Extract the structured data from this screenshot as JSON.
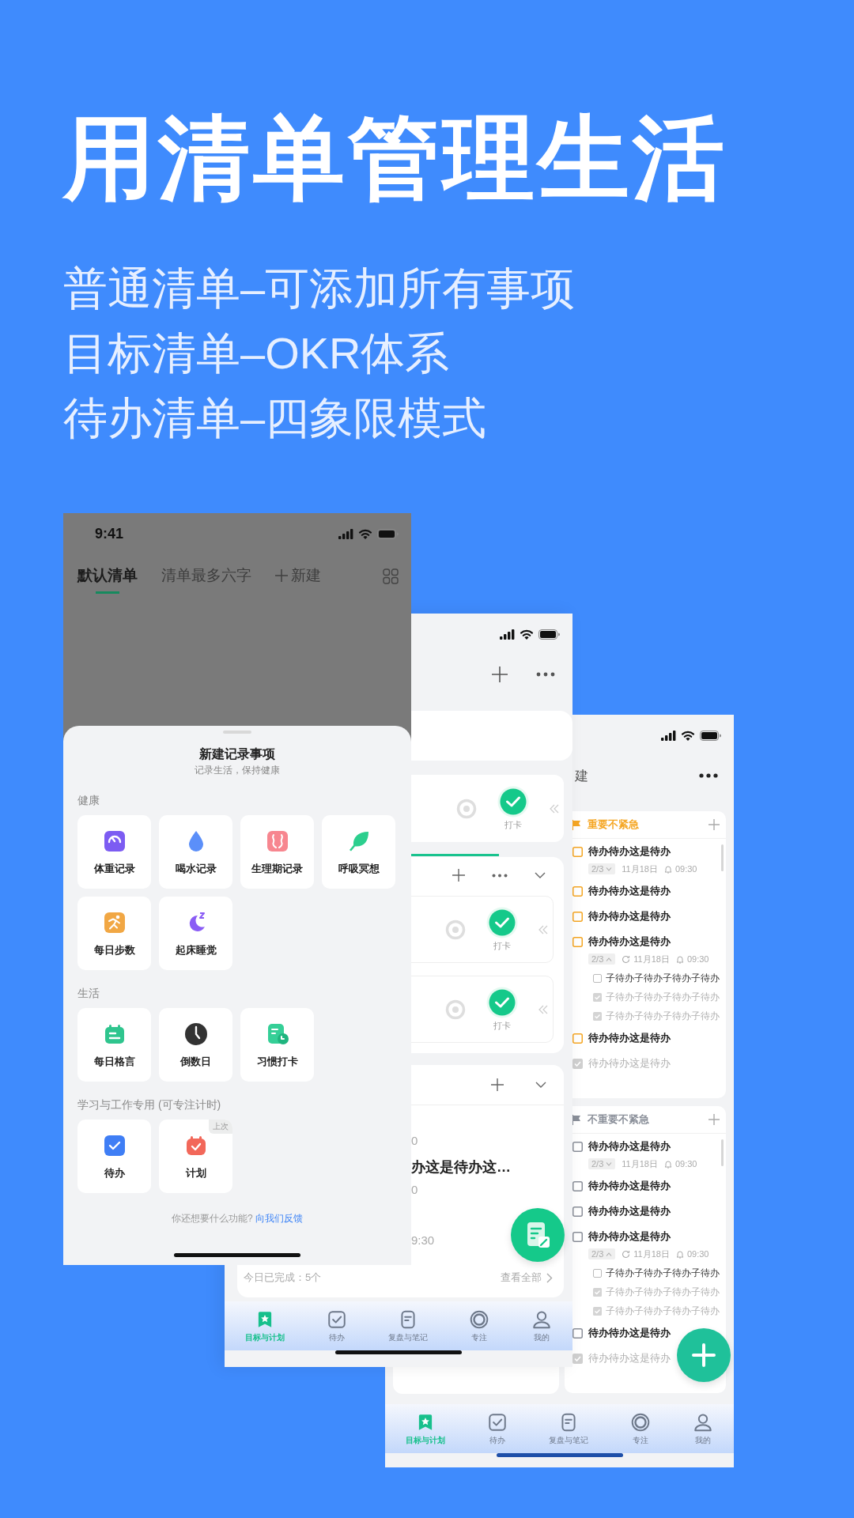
{
  "headline": "用清单管理生活",
  "taglines": [
    "普通清单–可添加所有事项",
    "目标清单–OKR体系",
    "待办清单–四象限模式"
  ],
  "list_screen": {
    "time": "9:41",
    "tabs": [
      {
        "label": "默认清单",
        "selected": true
      },
      {
        "label": "清单最多六字",
        "selected": false
      }
    ],
    "new_list": "新建",
    "sheet": {
      "title": "新建记录事项",
      "subtitle": "记录生活，保持健康",
      "sections": [
        {
          "title": "健康",
          "items": [
            {
              "label": "体重记录"
            },
            {
              "label": "喝水记录"
            },
            {
              "label": "生理期记录"
            },
            {
              "label": "呼吸冥想"
            },
            {
              "label": "每日步数"
            },
            {
              "label": "起床睡觉"
            }
          ]
        },
        {
          "title": "生活",
          "items": [
            {
              "label": "每日格言"
            },
            {
              "label": "倒数日"
            },
            {
              "label": "习惯打卡"
            }
          ]
        },
        {
          "title": "学习与工作专用 (可专注计时)",
          "items": [
            {
              "label": "待办"
            },
            {
              "label": "计划",
              "badge": "上次"
            }
          ]
        }
      ],
      "footer_question": "你还想要什么功能?",
      "footer_link": "向我们反馈"
    }
  },
  "goals_screen": {
    "checkin_groups": [
      {
        "kind": "single",
        "checkins": [
          "打卡"
        ]
      },
      {
        "kind": "group",
        "checkins": [
          "打卡",
          "打卡"
        ]
      }
    ],
    "todo_card": {
      "lines": [
        {
          "kind": "meta",
          "text": "0"
        },
        {
          "kind": "title",
          "text": "办这是待办这…"
        },
        {
          "kind": "meta",
          "text": "0"
        },
        {
          "kind": "time",
          "text": "9:30"
        }
      ],
      "completed": "今日已完成：5个",
      "view_all": "查看全部"
    },
    "tabs": [
      {
        "label": "目标与计划",
        "selected": true
      },
      {
        "label": "待办",
        "selected": false
      },
      {
        "label": "复盘与笔记",
        "selected": false
      },
      {
        "label": "专注",
        "selected": false
      },
      {
        "label": "我的",
        "selected": false
      }
    ]
  },
  "quadrant_screen": {
    "header": "建",
    "quadrants": [
      {
        "title": "重要不紧急",
        "color": "#f5a623",
        "tasks": [
          {
            "text": "待办待办这是待办",
            "checked": false,
            "meta": {
              "count": "2/3",
              "expanded": false,
              "repeat": false,
              "date": "11月18日",
              "time": "09:30"
            }
          },
          {
            "text": "待办待办这是待办",
            "checked": false
          },
          {
            "text": "待办待办这是待办",
            "checked": false
          },
          {
            "text": "待办待办这是待办",
            "checked": false,
            "meta": {
              "count": "2/3",
              "expanded": true,
              "repeat": true,
              "date": "11月18日",
              "time": "09:30"
            },
            "subtasks": [
              {
                "text": "子待办子待办子待办子待办",
                "checked": false
              },
              {
                "text": "子待办子待办子待办子待办",
                "checked": true
              },
              {
                "text": "子待办子待办子待办子待办",
                "checked": true
              }
            ]
          },
          {
            "text": "待办待办这是待办",
            "checked": false
          },
          {
            "text": "待办待办这是待办",
            "checked": true
          }
        ]
      },
      {
        "title": "不重要不紧急",
        "color": "#8a8f99",
        "tasks": [
          {
            "text": "待办待办这是待办",
            "checked": false,
            "meta": {
              "count": "2/3",
              "expanded": false,
              "repeat": false,
              "date": "11月18日",
              "time": "09:30"
            }
          },
          {
            "text": "待办待办这是待办",
            "checked": false
          },
          {
            "text": "待办待办这是待办",
            "checked": false
          },
          {
            "text": "待办待办这是待办",
            "checked": false,
            "meta": {
              "count": "2/3",
              "expanded": true,
              "repeat": true,
              "date": "11月18日",
              "time": "09:30"
            },
            "subtasks": [
              {
                "text": "子待办子待办子待办子待办",
                "checked": false
              },
              {
                "text": "子待办子待办子待办子待办",
                "checked": true
              },
              {
                "text": "子待办子待办子待办子待办",
                "checked": true
              }
            ]
          },
          {
            "text": "待办待办这是待办",
            "checked": false
          },
          {
            "text": "待办待办这是待办",
            "checked": true
          }
        ]
      }
    ],
    "tabs": [
      {
        "label": "目标与计划",
        "selected": true
      },
      {
        "label": "待办",
        "selected": false
      },
      {
        "label": "复盘与笔记",
        "selected": false
      },
      {
        "label": "专注",
        "selected": false
      },
      {
        "label": "我的",
        "selected": false
      }
    ]
  }
}
